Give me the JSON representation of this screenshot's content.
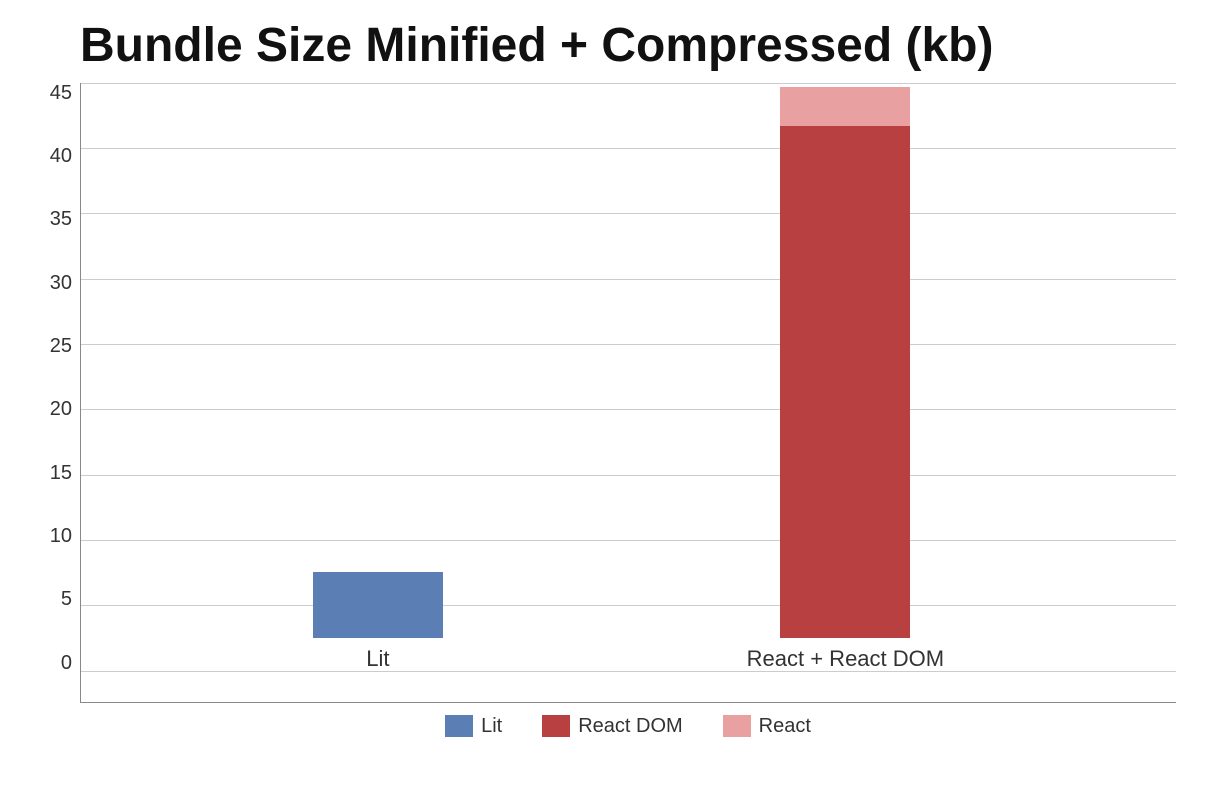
{
  "chart": {
    "title": "Bundle Size Minified + Compressed (kb)",
    "yAxis": {
      "labels": [
        "45",
        "40",
        "35",
        "30",
        "25",
        "20",
        "15",
        "10",
        "5",
        "0"
      ],
      "max": 45,
      "min": 0,
      "step": 5
    },
    "bars": [
      {
        "group": "Lit",
        "xLabel": "Lit",
        "segments": [
          {
            "name": "Lit",
            "value": 5,
            "color": "#5b7fb5"
          }
        ]
      },
      {
        "group": "React + React DOM",
        "xLabel": "React + React DOM",
        "segments": [
          {
            "name": "React DOM",
            "value": 39,
            "color": "#b94040"
          },
          {
            "name": "React",
            "value": 3,
            "color": "#e8a0a0"
          }
        ]
      }
    ],
    "legend": [
      {
        "name": "Lit",
        "color": "#5b7fb5"
      },
      {
        "name": "React DOM",
        "color": "#b94040"
      },
      {
        "name": "React",
        "color": "#e8a0a0"
      }
    ]
  }
}
